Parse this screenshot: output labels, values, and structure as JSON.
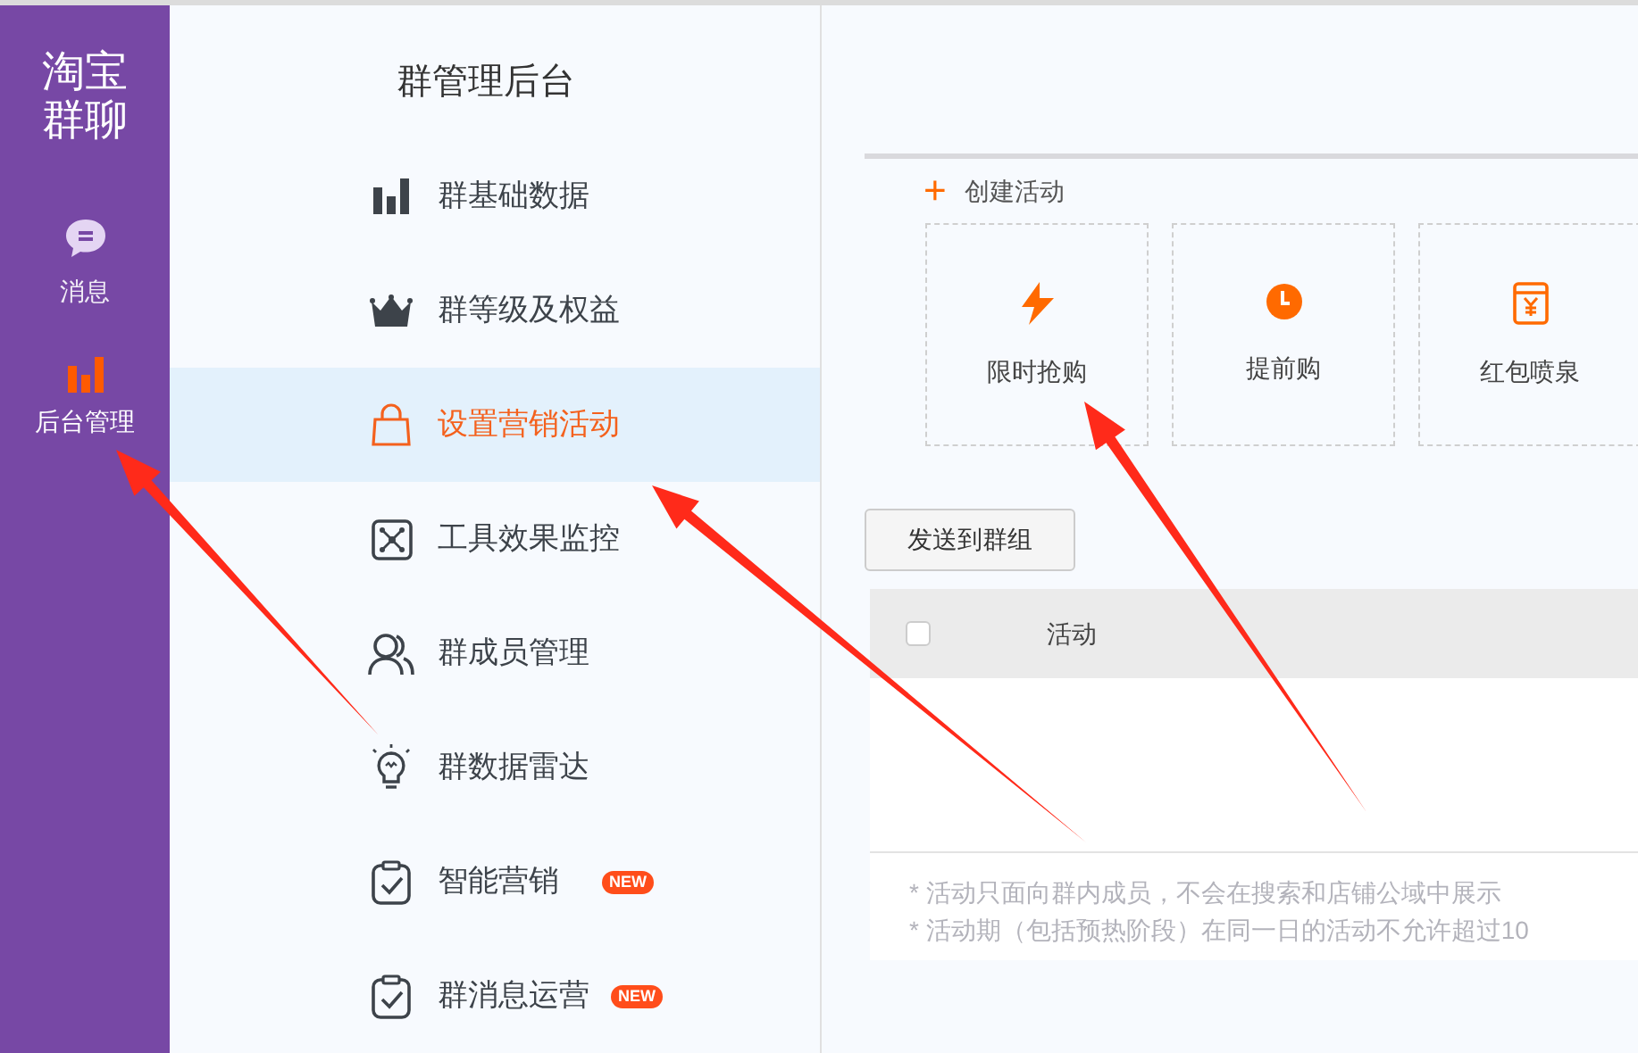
{
  "rail": {
    "logo": [
      "淘宝",
      "群聊"
    ],
    "items": [
      {
        "label": "消息",
        "kind": "chat",
        "selected": false
      },
      {
        "label": "后台管理",
        "kind": "bars",
        "selected": true
      }
    ]
  },
  "panel": {
    "title": "群管理后台",
    "items": [
      {
        "label": "群基础数据",
        "kind": "bars",
        "selected": false
      },
      {
        "label": "群等级及权益",
        "kind": "crown",
        "selected": false
      },
      {
        "label": "设置营销活动",
        "kind": "bag",
        "selected": true
      },
      {
        "label": "工具效果监控",
        "kind": "network",
        "selected": false
      },
      {
        "label": "群成员管理",
        "kind": "people",
        "selected": false
      },
      {
        "label": "群数据雷达",
        "kind": "bulb",
        "selected": false
      },
      {
        "label": "智能营销",
        "kind": "clipboard",
        "selected": false,
        "badge": "NEW"
      },
      {
        "label": "群消息运营",
        "kind": "clipboard",
        "selected": false,
        "badge": "NEW"
      }
    ]
  },
  "create": {
    "icon": "+",
    "label": "创建活动",
    "cards": [
      {
        "label": "限时抢购",
        "kind": "bolt"
      },
      {
        "label": "提前购",
        "kind": "clock"
      },
      {
        "label": "红包喷泉",
        "kind": "packet"
      }
    ]
  },
  "send_button": "发送到群组",
  "table": {
    "select_all": {
      "checked": false
    },
    "columns": [
      "活动"
    ]
  },
  "notes": [
    "* 活动只面向群内成员，不会在搜索和店铺公域中展示",
    "* 活动期（包括预热阶段）在同一日的活动不允许超过10"
  ]
}
